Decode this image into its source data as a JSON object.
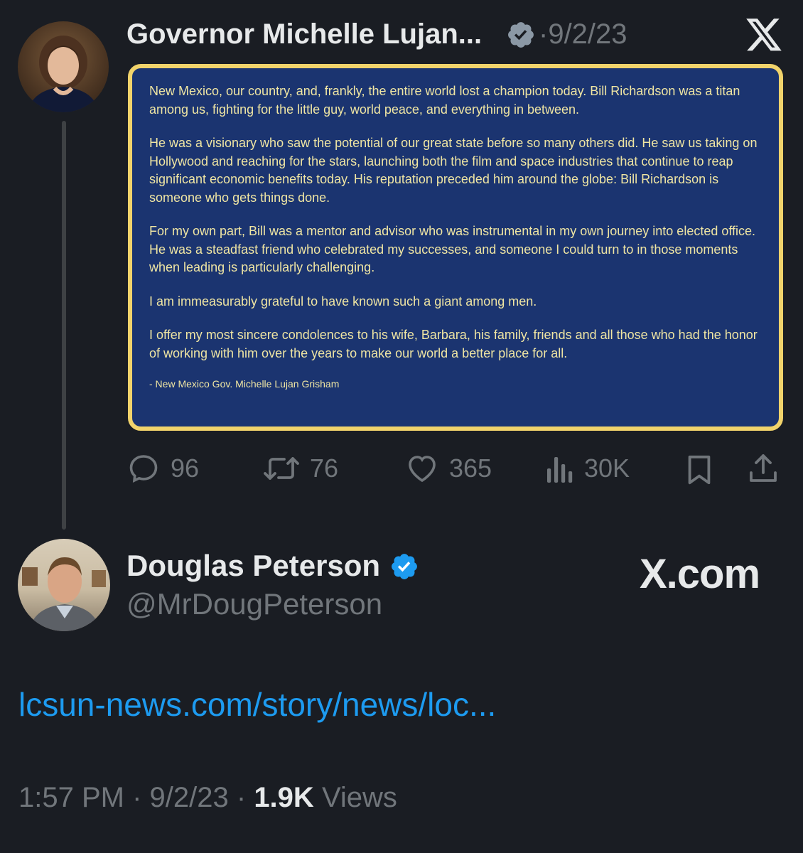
{
  "tweet1": {
    "author_name": "Governor Michelle Lujan...",
    "date": "·9/2/23",
    "card": {
      "paragraphs": [
        "New Mexico, our country, and, frankly, the entire world lost a champion today. Bill Richardson was a titan among us, fighting for the little guy, world peace, and everything in between.",
        "He was a visionary who saw the potential of our great state before so many others did. He saw us taking on Hollywood and reaching for the stars, launching both the film and space industries that continue to reap significant economic benefits today. His reputation preceded him around the globe: Bill Richardson is someone who gets things done.",
        "For my own part, Bill was a mentor and advisor who was instrumental in my own journey into elected office. He was a steadfast friend who celebrated my successes, and someone I could turn to in those moments when leading is particularly challenging.",
        "I am immeasurably grateful to have known such a giant among men.",
        "I offer my most sincere condolences to his wife, Barbara, his family, friends and all those who had the honor of working with him over the years to make our world a better place for all."
      ],
      "signature": "- New Mexico Gov. Michelle Lujan Grisham"
    },
    "stats": {
      "replies": "96",
      "retweets": "76",
      "likes": "365",
      "views": "30K"
    }
  },
  "tweet2": {
    "author_name": "Douglas Peterson",
    "handle": "@MrDougPeterson",
    "brand": "X.com",
    "link": "lcsun-news.com/story/news/loc...",
    "time": "1:57 PM",
    "date": "9/2/23",
    "views_count": "1.9K",
    "views_label": "Views"
  },
  "colors": {
    "background": "#1a1d23",
    "card_bg": "#1b3470",
    "card_border": "#f1d36b",
    "card_text": "#efe5a3",
    "link": "#1d9bf0",
    "muted": "#71767b",
    "verified_blue": "#1d9bf0",
    "verified_gray": "#8b98a5"
  }
}
